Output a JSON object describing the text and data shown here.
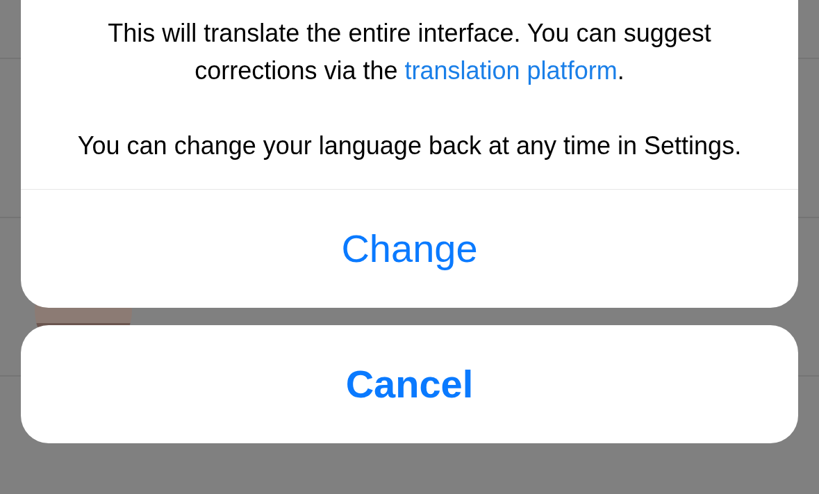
{
  "alert": {
    "message": [
      {
        "text": "This will translate the entire interface. You can suggest corrections via the ",
        "link": "translation platform",
        "after": "."
      },
      {
        "text": "You can change your language back at any time in Settings."
      }
    ],
    "actions": [
      {
        "label": "Change",
        "kind": "default"
      },
      {
        "label": "Cancel",
        "kind": "cancel"
      }
    ]
  }
}
